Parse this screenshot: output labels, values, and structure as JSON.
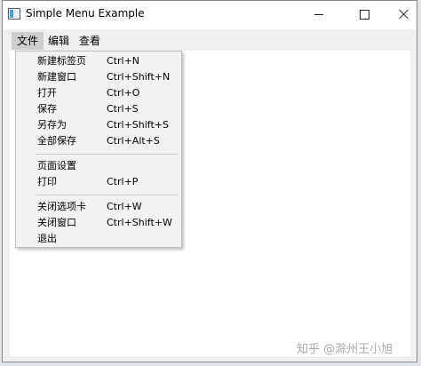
{
  "window": {
    "title": "Simple Menu Example"
  },
  "menubar": {
    "items": [
      {
        "label": "文件"
      },
      {
        "label": "编辑"
      },
      {
        "label": "查看"
      }
    ]
  },
  "file_menu": {
    "group1": [
      {
        "label": "新建标签页",
        "shortcut": "Ctrl+N"
      },
      {
        "label": "新建窗口",
        "shortcut": "Ctrl+Shift+N"
      },
      {
        "label": "打开",
        "shortcut": "Ctrl+O"
      },
      {
        "label": "保存",
        "shortcut": "Ctrl+S"
      },
      {
        "label": "另存为",
        "shortcut": "Ctrl+Shift+S"
      },
      {
        "label": "全部保存",
        "shortcut": "Ctrl+Alt+S"
      }
    ],
    "group2": [
      {
        "label": "页面设置",
        "shortcut": ""
      },
      {
        "label": "打印",
        "shortcut": "Ctrl+P"
      }
    ],
    "group3": [
      {
        "label": "关闭选项卡",
        "shortcut": "Ctrl+W"
      },
      {
        "label": "关闭窗口",
        "shortcut": "Ctrl+Shift+W"
      },
      {
        "label": "退出",
        "shortcut": ""
      }
    ]
  },
  "watermark": {
    "text": "知乎 @滁州王小旭"
  }
}
